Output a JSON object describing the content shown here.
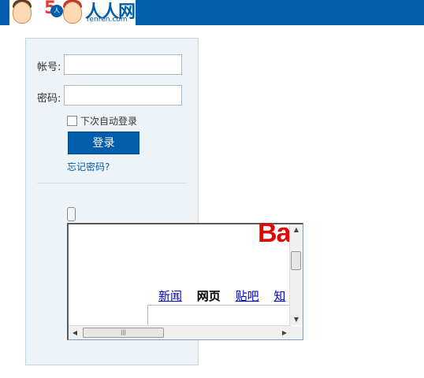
{
  "header": {
    "brand": "人人网",
    "brand_sub": "renren.com",
    "logo_number": "5",
    "logo_badge": "人"
  },
  "login": {
    "account_label": "帐号:",
    "account_value": "",
    "password_label": "密码:",
    "password_value": "",
    "remember_label": "下次自动登录",
    "remember_checked": false,
    "login_label": "登录",
    "forgot_label": "忘记密码?"
  },
  "embedded_frame": {
    "logo_text": "Ba",
    "nav": [
      "新闻",
      "网页",
      "贴吧",
      "知"
    ],
    "active_nav": "网页",
    "search_value": "",
    "hscroll_grip": "|||"
  },
  "colors": {
    "header_bg": "#005eac",
    "panel_bg": "#eef3f7",
    "button_bg": "#005eac",
    "link": "#005eac",
    "baidu_red": "#e10601",
    "baidu_link": "#0000cc"
  }
}
